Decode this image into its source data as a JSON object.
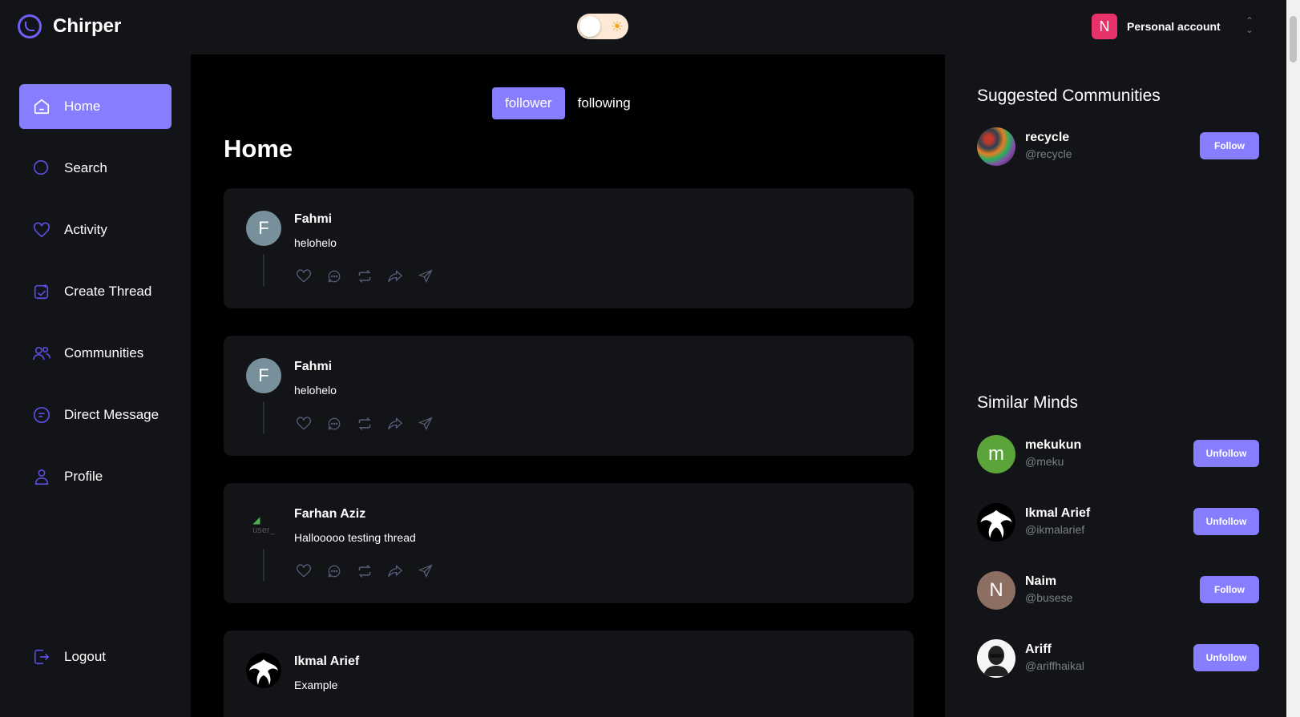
{
  "app": {
    "name": "Chirper"
  },
  "header": {
    "theme_toggle_icon": "sun-icon",
    "account_initial": "N",
    "account_label": "Personal account",
    "colors": {
      "accent": "#877eff",
      "account_badge": "#e8336a"
    }
  },
  "nav": {
    "items": [
      {
        "label": "Home",
        "icon": "home-icon",
        "active": true
      },
      {
        "label": "Search",
        "icon": "search-icon"
      },
      {
        "label": "Activity",
        "icon": "heart-icon"
      },
      {
        "label": "Create Thread",
        "icon": "create-thread-icon"
      },
      {
        "label": "Communities",
        "icon": "users-icon"
      },
      {
        "label": "Direct Message",
        "icon": "message-icon"
      },
      {
        "label": "Profile",
        "icon": "user-icon"
      }
    ],
    "logout": {
      "label": "Logout",
      "icon": "logout-icon"
    }
  },
  "main": {
    "tabs": [
      {
        "label": "follower",
        "active": true
      },
      {
        "label": "following",
        "active": false
      }
    ],
    "title": "Home",
    "posts": [
      {
        "author": "Fahmi",
        "initial": "F",
        "text": "helohelo"
      },
      {
        "author": "Fahmi",
        "initial": "F",
        "text": "helohelo"
      },
      {
        "author": "Farhan Aziz",
        "initial": "",
        "avatar_alt": "user_",
        "text": "Hallooooo testing thread"
      },
      {
        "author": "Ikmal Arief",
        "initial": "",
        "text": "Example"
      }
    ]
  },
  "right": {
    "communities_title": "Suggested Communities",
    "communities": [
      {
        "name": "recycle",
        "handle": "@recycle",
        "button": "Follow"
      }
    ],
    "similar_title": "Similar Minds",
    "people": [
      {
        "name": "mekukun",
        "handle": "@meku",
        "initial": "m",
        "color": "#5aa43a",
        "button": "Unfollow"
      },
      {
        "name": "Ikmal Arief",
        "handle": "@ikmalarief",
        "initial": "",
        "color": "#000000",
        "button": "Unfollow"
      },
      {
        "name": "Naim",
        "handle": "@busese",
        "initial": "N",
        "color": "#8d6e63",
        "button": "Follow"
      },
      {
        "name": "Ariff",
        "handle": "@ariffhaikal",
        "initial": "",
        "color": "#ffffff",
        "button": "Unfollow"
      }
    ]
  }
}
